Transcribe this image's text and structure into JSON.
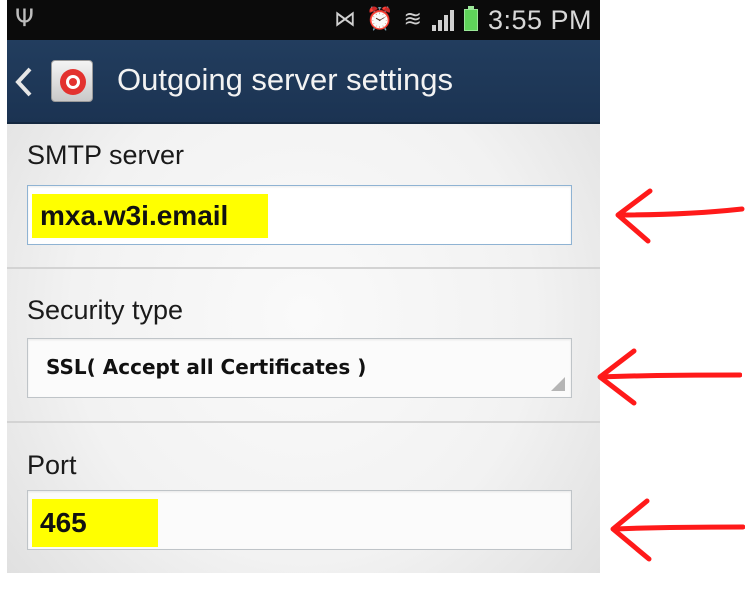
{
  "status_bar": {
    "time": "3:55 PM",
    "icons": [
      "usb-icon",
      "mute-icon",
      "alarm-icon",
      "wifi-icon",
      "signal-icon",
      "battery-icon"
    ]
  },
  "action_bar": {
    "title": "Outgoing server settings",
    "back_icon": "back-chevron-icon",
    "app_icon": "email-app-icon"
  },
  "smtp": {
    "label": "SMTP server",
    "value": "mxa.w3i.email"
  },
  "security": {
    "label": "Security type",
    "value": "SSL( Accept all Certificates )"
  },
  "port": {
    "label": "Port",
    "value": "465"
  },
  "colors": {
    "action_bar": "#1f3a5a",
    "highlight": "#ffff00",
    "arrow": "#ff1a1a"
  }
}
